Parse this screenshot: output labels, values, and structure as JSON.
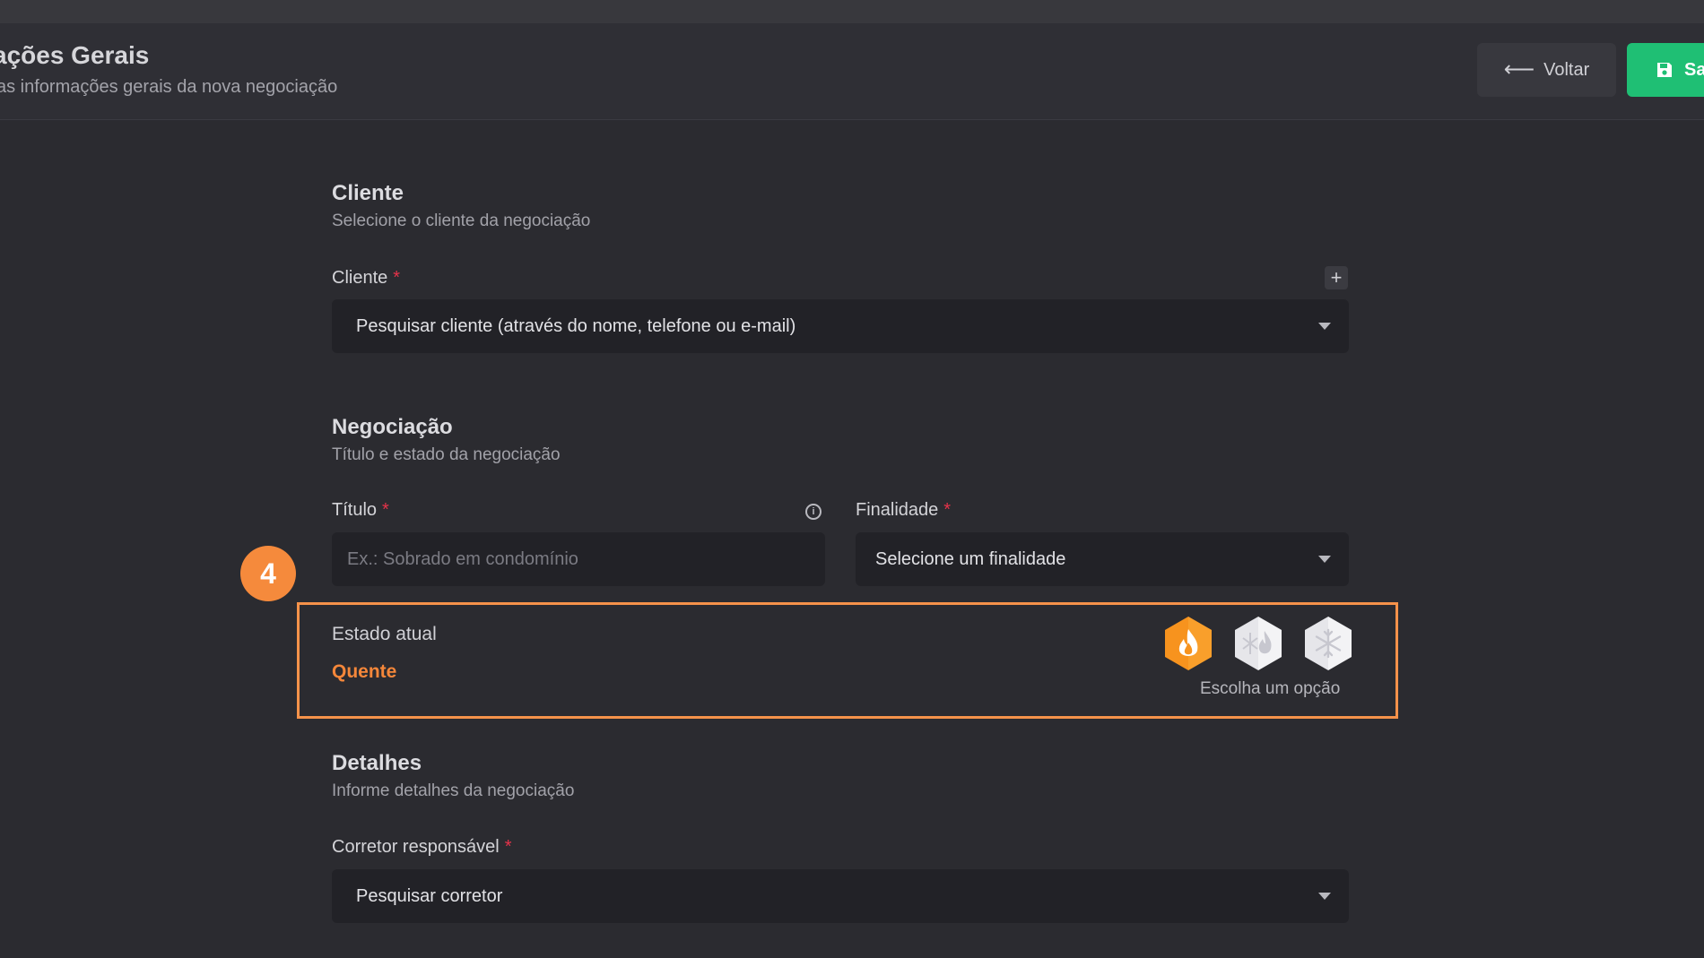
{
  "header": {
    "title": "ações Gerais",
    "subtitle": "as informações gerais da nova negociação",
    "back_label": "Voltar",
    "save_label": "Sa"
  },
  "client_section": {
    "title": "Cliente",
    "subtitle": "Selecione o cliente da negociação",
    "field_label": "Cliente",
    "required_mark": "*",
    "add_label": "+",
    "select_value": "Pesquisar cliente (através do nome, telefone ou e-mail)"
  },
  "negotiation_section": {
    "title": "Negociação",
    "subtitle": "Título e estado da negociação",
    "title_label": "Título",
    "title_placeholder": "Ex.: Sobrado em condomínio",
    "purpose_label": "Finalidade",
    "purpose_value": "Selecione um finalidade",
    "required_mark": "*",
    "info_glyph": "i"
  },
  "step_badge": "4",
  "state": {
    "label": "Estado atual",
    "value": "Quente",
    "hint": "Escolha um opção",
    "options": [
      {
        "name": "hot-fire-icon",
        "color": "#f7931e"
      },
      {
        "name": "warm-fire-snow-icon",
        "color": "#e8e8ec"
      },
      {
        "name": "cold-snowflake-icon",
        "color": "#e8e8ec"
      }
    ]
  },
  "details_section": {
    "title": "Detalhes",
    "subtitle": "Informe detalhes da negociação",
    "broker_label": "Corretor responsável",
    "required_mark": "*",
    "broker_value": "Pesquisar corretor"
  },
  "colors": {
    "accent_orange": "#f58a3c",
    "save_green": "#1fbf74",
    "required_red": "#e6334a"
  }
}
